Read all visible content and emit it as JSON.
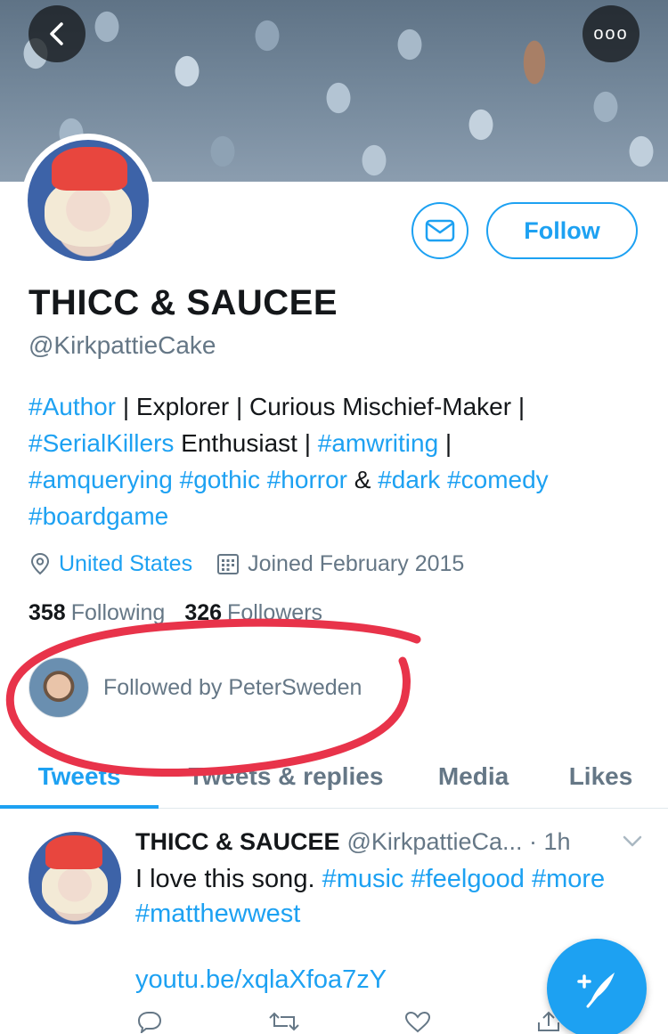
{
  "header": {
    "back_icon": "chevron-left-icon",
    "more_icon": "more-dots-icon",
    "more_label": "ooo"
  },
  "actions": {
    "message_icon": "mail-icon",
    "follow_label": "Follow"
  },
  "profile": {
    "name": "THICC & SAUCEE",
    "handle": "@KirkpattieCake",
    "bio": {
      "t1": "#Author",
      "t2": " | Explorer | Curious Mischief-Maker | ",
      "t3": "#SerialKillers",
      "t4": " Enthusiast | ",
      "t5": "#amwriting",
      "t6": " | ",
      "t7": "#amquerying",
      "t8": " ",
      "t9": "#gothic",
      "t10": " ",
      "t11": "#horror",
      "t12": " & ",
      "t13": "#dark",
      "t14": " ",
      "t15": "#comedy",
      "t16": " ",
      "t17": "#boardgame"
    },
    "location": "United States",
    "joined": "Joined February 2015",
    "following_count": "358",
    "following_label": "Following",
    "followers_count": "326",
    "followers_label": "Followers",
    "followed_by": "Followed by PeterSweden"
  },
  "tabs": [
    {
      "label": "Tweets"
    },
    {
      "label": "Tweets & replies"
    },
    {
      "label": "Media"
    },
    {
      "label": "Likes"
    }
  ],
  "tweet": {
    "name": "THICC & SAUCEE",
    "handle_time": "@KirkpattieCa... · 1h",
    "text_plain": "I love this song. ",
    "hashtags": {
      "h1": "#music",
      "h2": "#feelgood",
      "h3": "#more",
      "h4": "#matthewwest"
    },
    "link": "youtu.be/xqlaXfoa7zY"
  },
  "colors": {
    "accent": "#1da1f2",
    "annotation": "#e8334a"
  }
}
